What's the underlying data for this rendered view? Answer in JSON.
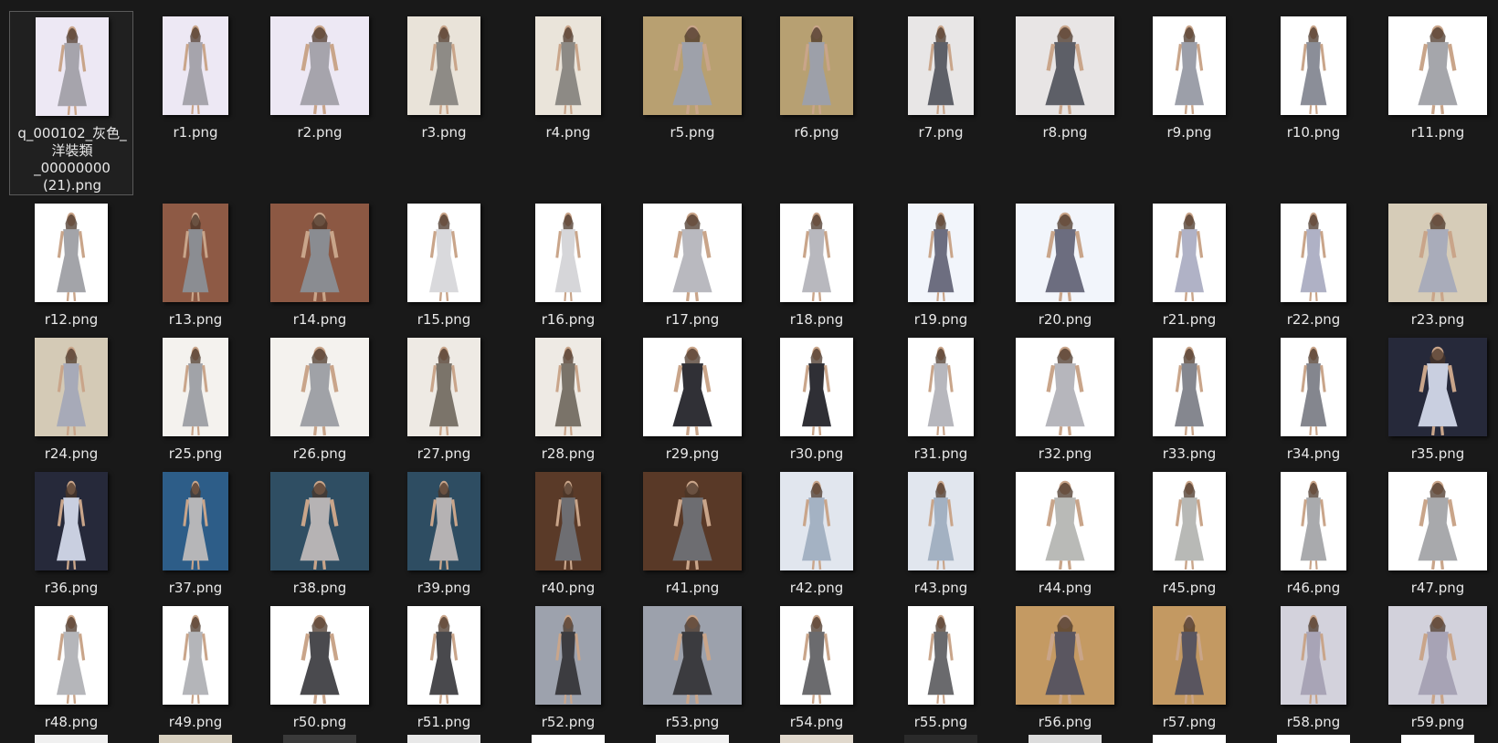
{
  "folder": {
    "files": [
      {
        "name": "q_000102_灰色_洋裝類_00000000(21).png",
        "label_lines": [
          "q_000102_灰色_",
          "洋裝類",
          "_00000000",
          "(21).png"
        ],
        "selected": true,
        "palette": [
          "#ede8f4",
          "#a6a4ac"
        ]
      },
      {
        "name": "r1.png",
        "palette": [
          "#ede8f4",
          "#a6a4ac"
        ]
      },
      {
        "name": "r2.png",
        "palette": [
          "#ede8f4",
          "#a6a4ac"
        ]
      },
      {
        "name": "r3.png",
        "palette": [
          "#e9e3d9",
          "#8e8b86"
        ]
      },
      {
        "name": "r4.png",
        "palette": [
          "#eae4da",
          "#8d8a85"
        ]
      },
      {
        "name": "r5.png",
        "palette": [
          "#b8a071",
          "#9ea1aa"
        ]
      },
      {
        "name": "r6.png",
        "palette": [
          "#b7a072",
          "#9da0a9"
        ]
      },
      {
        "name": "r7.png",
        "palette": [
          "#e8e6e6",
          "#5e6068"
        ]
      },
      {
        "name": "r8.png",
        "palette": [
          "#e8e5e5",
          "#5d5f67"
        ]
      },
      {
        "name": "r9.png",
        "palette": [
          "#ffffff",
          "#9c9fa9"
        ]
      },
      {
        "name": "r10.png",
        "palette": [
          "#ffffff",
          "#8b8e98"
        ]
      },
      {
        "name": "r11.png",
        "palette": [
          "#ffffff",
          "#a5a6ab"
        ]
      },
      {
        "name": "r12.png",
        "palette": [
          "#ffffff",
          "#a3a4a9"
        ]
      },
      {
        "name": "r13.png",
        "palette": [
          "#8e5a45",
          "#8b8d92"
        ]
      },
      {
        "name": "r14.png",
        "palette": [
          "#8c5843",
          "#8a8c91"
        ]
      },
      {
        "name": "r15.png",
        "palette": [
          "#ffffff",
          "#d9d9dc"
        ]
      },
      {
        "name": "r16.png",
        "palette": [
          "#ffffff",
          "#d6d6d9"
        ]
      },
      {
        "name": "r17.png",
        "palette": [
          "#ffffff",
          "#b9b9bf"
        ]
      },
      {
        "name": "r18.png",
        "palette": [
          "#ffffff",
          "#b8b8be"
        ]
      },
      {
        "name": "r19.png",
        "palette": [
          "#f2f5fb",
          "#6d6e80"
        ]
      },
      {
        "name": "r20.png",
        "palette": [
          "#f2f5fb",
          "#6c6d7f"
        ]
      },
      {
        "name": "r21.png",
        "palette": [
          "#ffffff",
          "#b0b2c6"
        ]
      },
      {
        "name": "r22.png",
        "palette": [
          "#ffffff",
          "#afb1c5"
        ]
      },
      {
        "name": "r23.png",
        "palette": [
          "#d6ccb8",
          "#a9acba"
        ]
      },
      {
        "name": "r24.png",
        "palette": [
          "#d4cab6",
          "#a7aab8"
        ]
      },
      {
        "name": "r25.png",
        "palette": [
          "#f4f2ee",
          "#a1a3a8"
        ]
      },
      {
        "name": "r26.png",
        "palette": [
          "#f4f2ee",
          "#a0a2a7"
        ]
      },
      {
        "name": "r27.png",
        "palette": [
          "#eeeae4",
          "#7b746a"
        ]
      },
      {
        "name": "r28.png",
        "palette": [
          "#eeeae4",
          "#7a7369"
        ]
      },
      {
        "name": "r29.png",
        "palette": [
          "#ffffff",
          "#303036"
        ]
      },
      {
        "name": "r30.png",
        "palette": [
          "#ffffff",
          "#2f2f35"
        ]
      },
      {
        "name": "r31.png",
        "palette": [
          "#ffffff",
          "#b7b7bd"
        ]
      },
      {
        "name": "r32.png",
        "palette": [
          "#ffffff",
          "#b6b6bc"
        ]
      },
      {
        "name": "r33.png",
        "palette": [
          "#ffffff",
          "#85878f"
        ]
      },
      {
        "name": "r34.png",
        "palette": [
          "#ffffff",
          "#84868e"
        ]
      },
      {
        "name": "r35.png",
        "palette": [
          "#26293a",
          "#c9cfe0"
        ]
      },
      {
        "name": "r36.png",
        "palette": [
          "#26293a",
          "#c9cfe0"
        ]
      },
      {
        "name": "r37.png",
        "palette": [
          "#2d5d88",
          "#b6b6b8"
        ]
      },
      {
        "name": "r38.png",
        "palette": [
          "#2f4e63",
          "#b6b3b4"
        ]
      },
      {
        "name": "r39.png",
        "palette": [
          "#2e4d62",
          "#b5b2b3"
        ]
      },
      {
        "name": "r40.png",
        "palette": [
          "#5a3a28",
          "#6e6e72"
        ]
      },
      {
        "name": "r41.png",
        "palette": [
          "#593927",
          "#6d6d71"
        ]
      },
      {
        "name": "r42.png",
        "palette": [
          "#e1e6ee",
          "#a4b2c3"
        ]
      },
      {
        "name": "r43.png",
        "palette": [
          "#e1e6ee",
          "#a3b1c2"
        ]
      },
      {
        "name": "r44.png",
        "palette": [
          "#ffffff",
          "#b9bab7"
        ]
      },
      {
        "name": "r45.png",
        "palette": [
          "#ffffff",
          "#b8b9b6"
        ]
      },
      {
        "name": "r46.png",
        "palette": [
          "#ffffff",
          "#a9aaad"
        ]
      },
      {
        "name": "r47.png",
        "palette": [
          "#ffffff",
          "#a8a9ac"
        ]
      },
      {
        "name": "r48.png",
        "palette": [
          "#ffffff",
          "#b5b6ba"
        ]
      },
      {
        "name": "r49.png",
        "palette": [
          "#ffffff",
          "#b4b5b9"
        ]
      },
      {
        "name": "r50.png",
        "palette": [
          "#ffffff",
          "#4a4a4e"
        ]
      },
      {
        "name": "r51.png",
        "palette": [
          "#ffffff",
          "#49494d"
        ]
      },
      {
        "name": "r52.png",
        "palette": [
          "#9da2ad",
          "#3c3c40"
        ]
      },
      {
        "name": "r53.png",
        "palette": [
          "#9ca1ac",
          "#3b3b3f"
        ]
      },
      {
        "name": "r54.png",
        "palette": [
          "#ffffff",
          "#6b6b6e"
        ]
      },
      {
        "name": "r55.png",
        "palette": [
          "#ffffff",
          "#6a6a6d"
        ]
      },
      {
        "name": "r56.png",
        "palette": [
          "#c49a63",
          "#5a5660"
        ]
      },
      {
        "name": "r57.png",
        "palette": [
          "#c39962",
          "#59555f"
        ]
      },
      {
        "name": "r58.png",
        "palette": [
          "#d3d2dc",
          "#a8a4b6"
        ]
      },
      {
        "name": "r59.png",
        "palette": [
          "#d2d1db",
          "#a7a3b5"
        ]
      }
    ],
    "partial_row_palette": [
      "#f0f0f0",
      "#d8d0c0",
      "#3a3a3a",
      "#e8e8e8",
      "#ffffff",
      "#f2f2f2",
      "#e0d8cc",
      "#2a2a2a",
      "#dcdcdc",
      "#ffffff",
      "#ffffff",
      "#ffffff"
    ]
  }
}
